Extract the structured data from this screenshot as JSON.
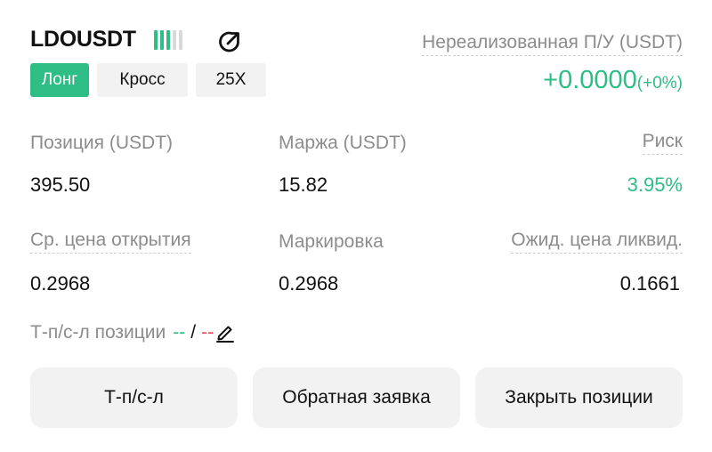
{
  "header": {
    "symbol": "LDOUSDT",
    "side": "Лонг",
    "margin_mode": "Кросс",
    "leverage": "25X",
    "signal_bars_active": 3,
    "signal_bars_total": 5
  },
  "pnl": {
    "label": "Нереализованная П/У (USDT)",
    "value": "+0.0000",
    "percent": "(+0%)"
  },
  "stats_row1": {
    "position_label": "Позиция (USDT)",
    "position_value": "395.50",
    "margin_label": "Маржа (USDT)",
    "margin_value": "15.82",
    "risk_label": "Риск",
    "risk_value": "3.95%"
  },
  "stats_row2": {
    "entry_label": "Ср. цена открытия",
    "entry_value": "0.2968",
    "mark_label": "Маркировка",
    "mark_value": "0.2968",
    "liq_label": "Ожид. цена ликвид.",
    "liq_value": "0.1661"
  },
  "tpsl": {
    "label": "Т-п/с-л позиции",
    "tp": "--",
    "separator": "/",
    "sl": "--"
  },
  "buttons": {
    "tpsl": "Т-п/с-л",
    "reverse": "Обратная заявка",
    "close": "Закрыть позиции"
  },
  "colors": {
    "accent_green": "#2ebd85",
    "accent_red": "#f6465d",
    "muted_text": "#8c8c8c",
    "button_bg": "#f2f2f2"
  },
  "icons": {
    "share": "share-icon",
    "edit": "edit-pencil-icon",
    "signal": "signal-bars-icon"
  }
}
